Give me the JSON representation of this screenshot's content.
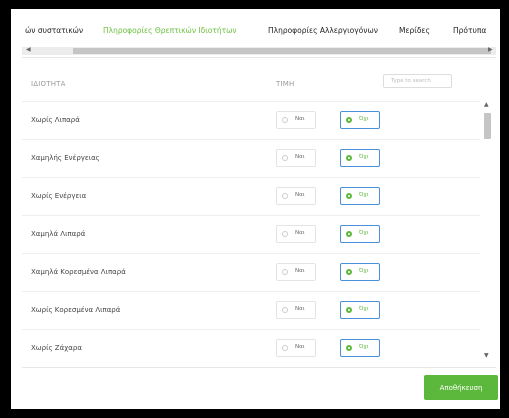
{
  "tabs": [
    {
      "label": "ών συστατικών",
      "active": false
    },
    {
      "label": "Πληροφορίες Θρεπτικών Ιδιοτήτων",
      "active": true
    },
    {
      "label": "Πληροφορίες Αλλεργιογόνων",
      "active": false
    },
    {
      "label": "Μερίδες",
      "active": false
    },
    {
      "label": "Πρότυπα",
      "active": false
    }
  ],
  "table": {
    "col_property": "ΙΔΙΟΤΗΤΑ",
    "col_value": "ΤΙΜΗ",
    "search_placeholder": "Type to search",
    "rows": [
      {
        "name": "Χωρίς Λιπαρά",
        "yes_label": "Ναι",
        "no_label": "Όχι",
        "selected": "no"
      },
      {
        "name": "Χαμηλής Ενέργειας",
        "yes_label": "Ναι",
        "no_label": "Όχι",
        "selected": "no"
      },
      {
        "name": "Χωρίς Ενέργεια",
        "yes_label": "Ναι",
        "no_label": "Όχι",
        "selected": "no"
      },
      {
        "name": "Χαμηλά Λιπαρά",
        "yes_label": "Ναι",
        "no_label": "Όχι",
        "selected": "no"
      },
      {
        "name": "Χαμηλά Κορεσμένα Λιπαρά",
        "yes_label": "Ναι",
        "no_label": "Όχι",
        "selected": "no"
      },
      {
        "name": "Χωρίς Κορεσμένα Λιπαρά",
        "yes_label": "Ναι",
        "no_label": "Όχι",
        "selected": "no"
      },
      {
        "name": "Χωρίς Ζάχαρα",
        "yes_label": "Ναι",
        "no_label": "Όχι",
        "selected": "no"
      }
    ]
  },
  "footer": {
    "save_label": "Αποθήκευση"
  },
  "colors": {
    "accent_green": "#5cb83c",
    "selected_border": "#4a8fd9"
  },
  "icons": {
    "scroll_left": "◀",
    "scroll_right": "▶",
    "scroll_up": "▲",
    "scroll_down": "▼"
  }
}
